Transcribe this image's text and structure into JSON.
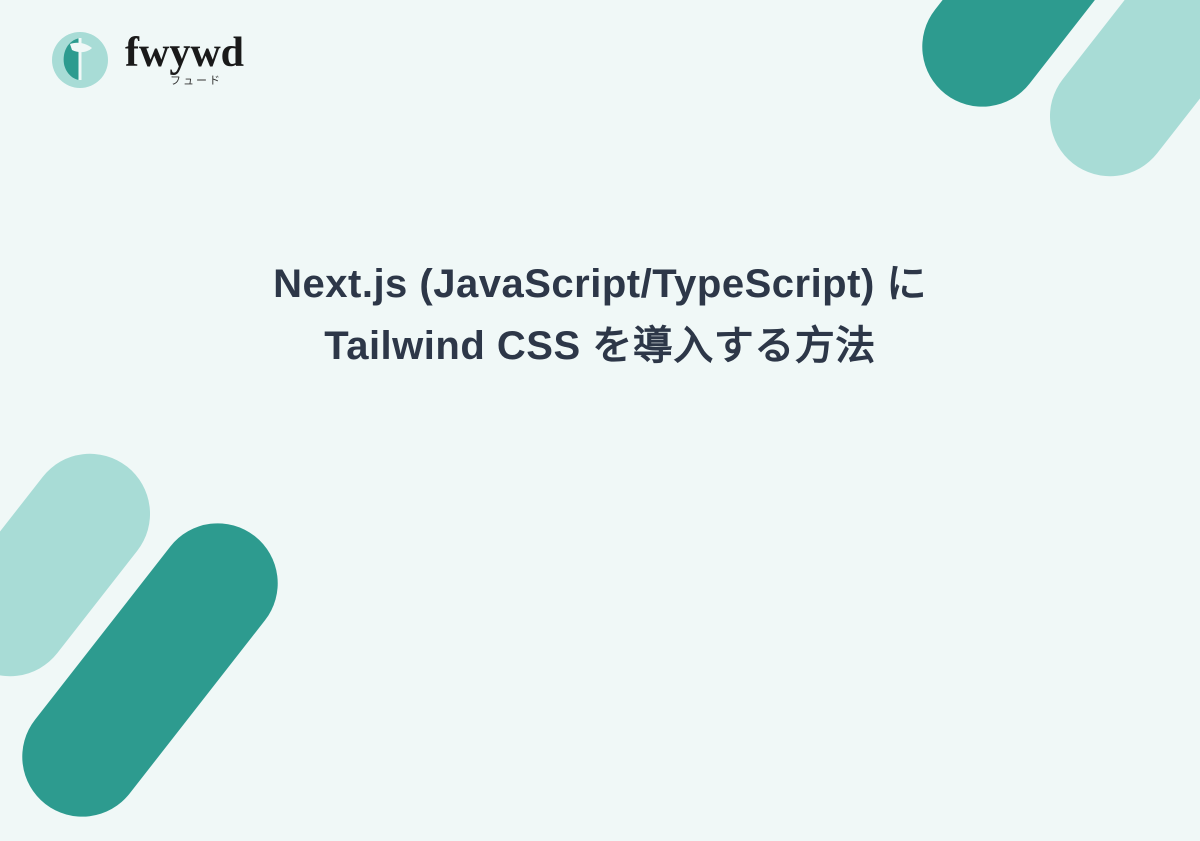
{
  "brand": {
    "name": "fwywd",
    "subtitle": "フュード"
  },
  "title": {
    "line1": "Next.js (JavaScript/TypeScript) に",
    "line2": "Tailwind CSS を導入する方法"
  },
  "colors": {
    "accent_dark": "#2d9b8f",
    "accent_light": "#a8dcd6",
    "background": "#f0f8f7",
    "text_dark": "#2d3748"
  }
}
